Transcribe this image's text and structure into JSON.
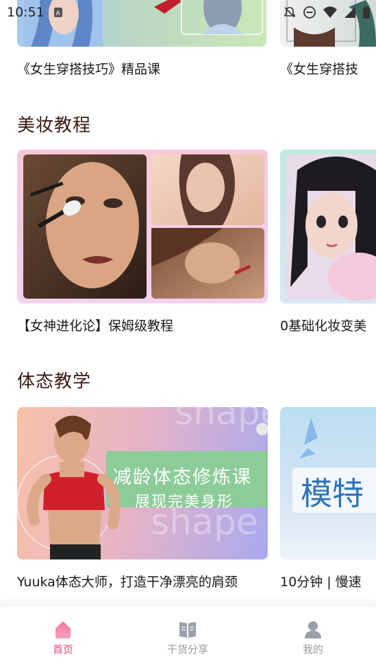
{
  "status_bar": {
    "time": "10:51"
  },
  "top_row": {
    "cards": [
      {
        "caption": "《女生穿搭技巧》精品课"
      },
      {
        "caption": "《女生穿搭技"
      }
    ]
  },
  "sections": [
    {
      "title": "美妆教程",
      "cards": [
        {
          "caption": "【女神进化论】保姆级教程"
        },
        {
          "caption": "0基础化妆变美"
        }
      ]
    },
    {
      "title": "体态教学",
      "cards": [
        {
          "caption": "Yuuka体态大师，打造干净漂亮的肩颈",
          "banner_line1": "减龄体态修炼课",
          "banner_line2": "展现完美身形",
          "watermark": "shape"
        },
        {
          "caption": "10分钟 | 慢速",
          "banner_text": "模特"
        }
      ]
    }
  ],
  "tabbar": {
    "tabs": [
      {
        "label": "首页",
        "icon": "home-icon",
        "active": true
      },
      {
        "label": "干货分享",
        "icon": "book-icon",
        "active": false
      },
      {
        "label": "我的",
        "icon": "profile-icon",
        "active": false
      }
    ],
    "active_color": "#e8447a",
    "inactive_color": "#9a9a9a"
  }
}
